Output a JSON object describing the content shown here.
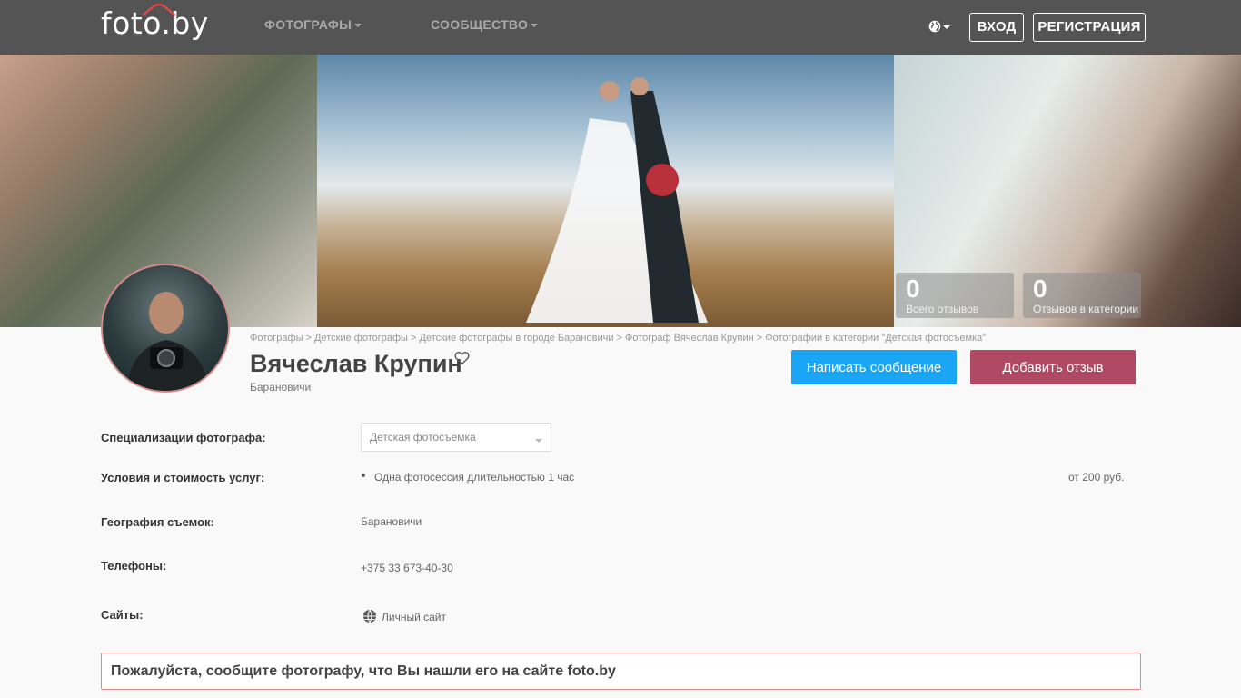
{
  "nav": {
    "logo": "foto.by",
    "photographers": "ФОТОГРАФЫ",
    "community": "СООБЩЕСТВО",
    "login": "ВХОД",
    "register": "РЕГИСТРАЦИЯ",
    "language_icon": "globe-icon"
  },
  "hero": {
    "stats": [
      {
        "value": "0",
        "label": "Всего отзывов"
      },
      {
        "value": "0",
        "label": "Отзывов в категории"
      }
    ]
  },
  "profile": {
    "breadcrumbs": [
      "Фотографы",
      "Детские фотографы",
      "Детские фотографы в городе Барановичи",
      "Фотограф Вячеслав Крупин",
      "Фотографии в категории \"Детская фотосъемка\""
    ],
    "breadcrumb_sep": " > ",
    "name": "Вячеслав Крупин",
    "city": "Барановичи",
    "write_message": "Написать сообщение",
    "add_review": "Добавить отзыв"
  },
  "info": {
    "specializations_label": "Специализации фотографа:",
    "specializations_value": "Детская фотосъемка",
    "services_label": "Условия и стоимость услуг:",
    "service_name": "Одна фотосессия длительностью 1 час",
    "service_price": "от 200 руб.",
    "geo_label": "География съемок:",
    "geo_value": "Барановичи",
    "phones_label": "Телефоны:",
    "phone": "+375 33 673-40-30",
    "sites_label": "Сайты:",
    "site": "Личный сайт"
  },
  "notice": "Пожалуйста, сообщите фотографу, что Вы нашли его на сайте foto.by",
  "colors": {
    "nav_bg": "#545454",
    "message_btn": "#1aa5f5",
    "review_btn": "#b04a64",
    "notice_border": "#e58a8a"
  }
}
